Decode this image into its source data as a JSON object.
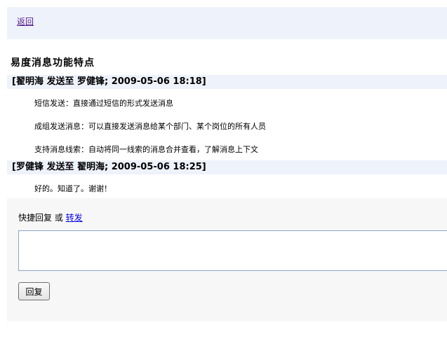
{
  "nav": {
    "back_label": "返回"
  },
  "page": {
    "title": "易度消息功能特点"
  },
  "messages": [
    {
      "header": "[翟明海 发送至 罗健锋; 2009-05-06 18:18]",
      "lines": [
        "短信发送：直接通过短信的形式发送消息",
        "成组发送消息：可以直接发送消息给某个部门、某个岗位的所有人员",
        "支持消息线索：自动将同一线索的消息合并查看，了解消息上下文"
      ]
    },
    {
      "header": "[罗健锋 发送至 翟明海; 2009-05-06 18:25]",
      "lines": [
        "好的。知道了。谢谢！"
      ]
    }
  ],
  "reply": {
    "prefix_label": "快捷回复 或 ",
    "forward_label": "转发",
    "input_value": "",
    "button_label": "回复"
  },
  "colors": {
    "header_bg": "#eef2fb",
    "reply_bg": "#f7f7f7",
    "link_visited": "#551a8b",
    "link": "#0000ee"
  }
}
